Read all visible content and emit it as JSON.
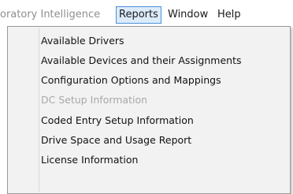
{
  "menubar": {
    "items": [
      {
        "label": "oratory Intelligence",
        "state": "faded"
      },
      {
        "label": "Reports",
        "state": "active"
      },
      {
        "label": "Window",
        "state": "normal"
      },
      {
        "label": "Help",
        "state": "normal"
      }
    ]
  },
  "reports_menu": {
    "items": [
      {
        "label": "Available Drivers",
        "enabled": true
      },
      {
        "label": "Available Devices and their Assignments",
        "enabled": true
      },
      {
        "label": "Configuration Options and Mappings",
        "enabled": true
      },
      {
        "label": "DC Setup Information",
        "enabled": false
      },
      {
        "label": "Coded Entry Setup Information",
        "enabled": true
      },
      {
        "label": "Drive Space and Usage Report",
        "enabled": true
      },
      {
        "label": "License Information",
        "enabled": true
      }
    ]
  },
  "colors": {
    "active_border": "#4a90d9",
    "active_fill": "#dcebfa",
    "menu_bg": "#f2f2f2",
    "disabled_text": "#a8a8a8"
  }
}
